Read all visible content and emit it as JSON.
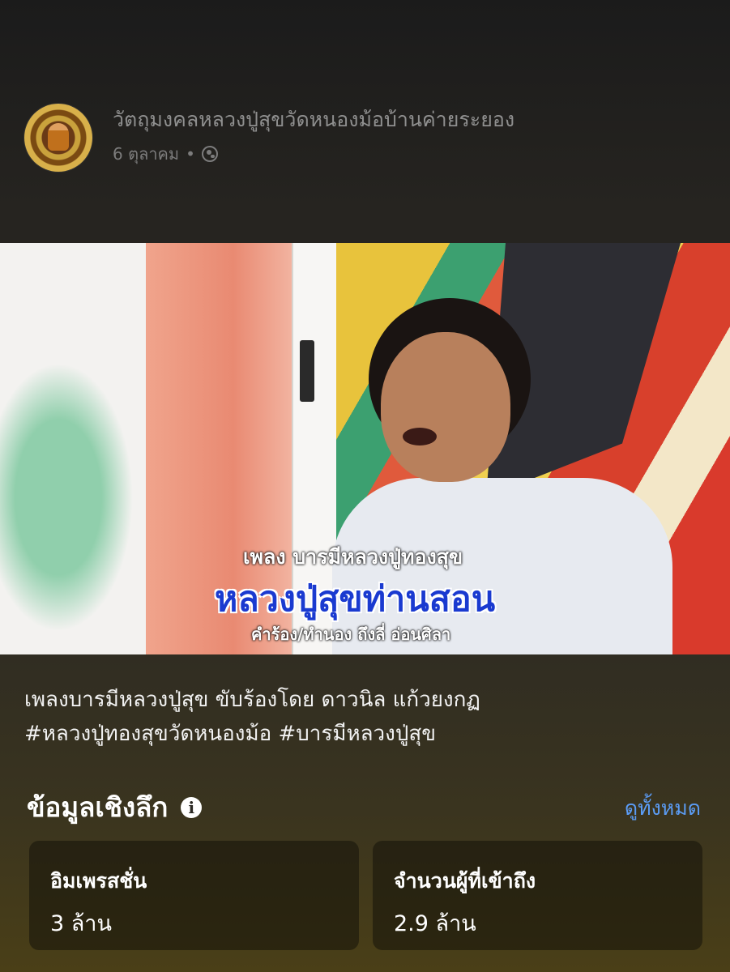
{
  "post": {
    "page_name": "วัตถุมงคลหลวงปู่สุขวัดหนองม้อบ้านค่ายระยอง",
    "date": "6 ตุลาคม",
    "separator": "•",
    "audience_icon": "globe-icon"
  },
  "video": {
    "caption_line1": "เพลง บารมีหลวงปู่ทองสุข",
    "caption_line2": "หลวงปู่สุขท่านสอน",
    "caption_line3": "คำร้อง/ทำนอง ถึงลี่ อ่อนศิลา"
  },
  "description": {
    "line1": "เพลงบารมีหลวงปู่สุข ขับร้องโดย ดาวนิล แก้วยงกฏ",
    "line2": "#หลวงปู่ทองสุขวัดหนองม้อ #บารมีหลวงปู่สุข"
  },
  "insights": {
    "title": "ข้อมูลเชิงลึก",
    "info_icon": "i",
    "see_all": "ดูทั้งหมด",
    "cards": [
      {
        "label": "อิมเพรสชั่น",
        "value": "3 ล้าน"
      },
      {
        "label": "จำนวนผู้ที่เข้าถึง",
        "value": "2.9 ล้าน"
      }
    ]
  },
  "colors": {
    "link": "#5b9cf5",
    "caption_blue": "#1a3ad0"
  }
}
